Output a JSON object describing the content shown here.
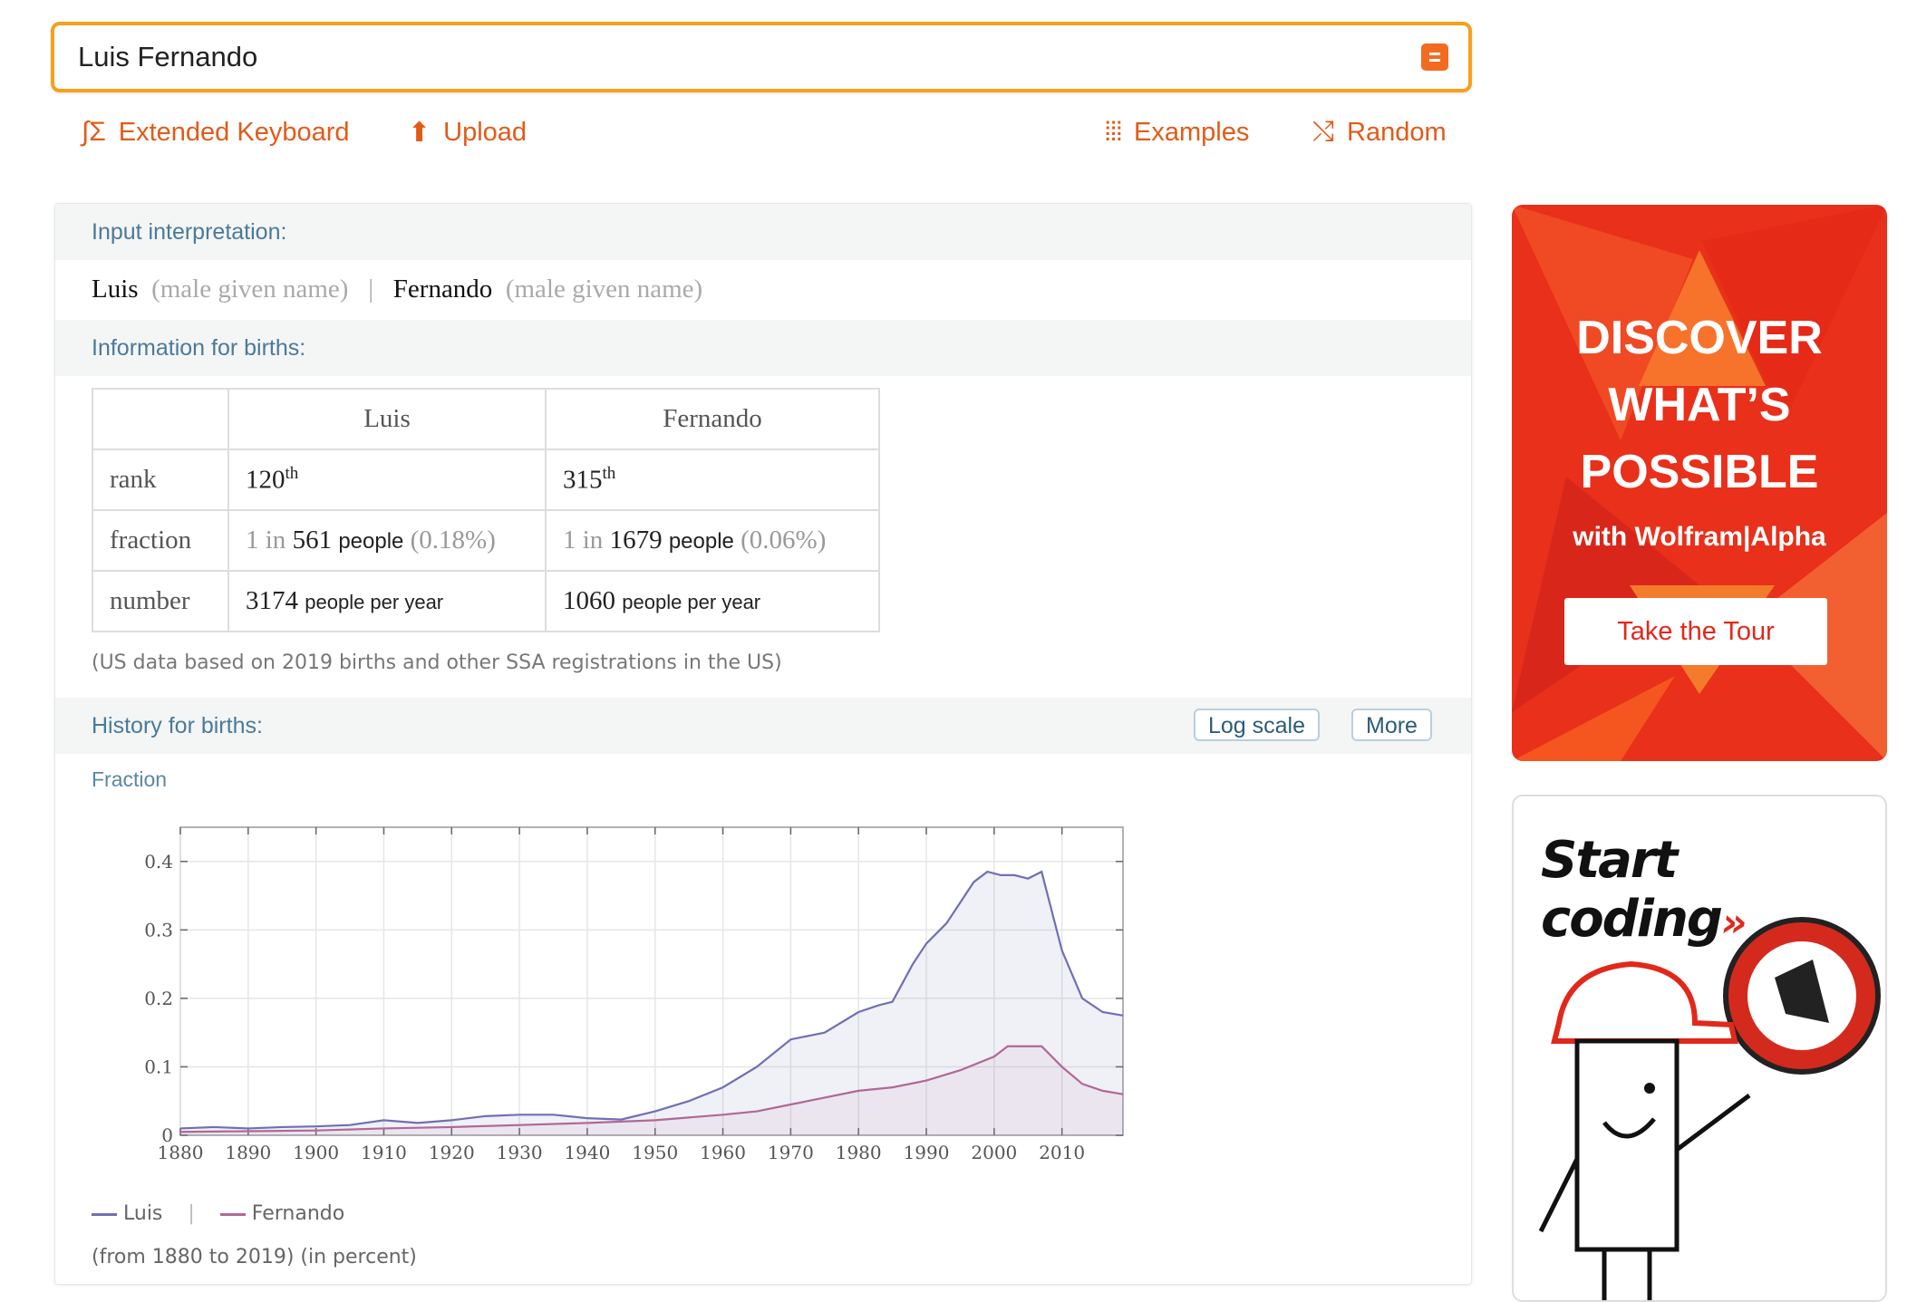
{
  "search": {
    "value": "Luis Fernando"
  },
  "toolbar": {
    "extended_keyboard": "Extended Keyboard",
    "upload": "Upload",
    "examples": "Examples",
    "random": "Random"
  },
  "pods": {
    "input_interpretation": {
      "title": "Input interpretation:",
      "name1": "Luis",
      "type1": "(male given name)",
      "separator": "|",
      "name2": "Fernando",
      "type2": "(male given name)"
    },
    "births_info": {
      "title": "Information for births:",
      "columns": [
        "Luis",
        "Fernando"
      ],
      "rank": {
        "label": "rank",
        "luis": "120",
        "luis_sup": "th",
        "fernando": "315",
        "fernando_sup": "th"
      },
      "fraction": {
        "label": "fraction",
        "luis_prefix": "1 in",
        "luis_value": "561",
        "luis_unit": "people",
        "luis_pct": "(0.18%)",
        "fernando_prefix": "1 in",
        "fernando_value": "1679",
        "fernando_unit": "people",
        "fernando_pct": "(0.06%)"
      },
      "number": {
        "label": "number",
        "luis_value": "3174",
        "luis_unit": "people per year",
        "fernando_value": "1060",
        "fernando_unit": "people per year"
      },
      "note": "(US data based on 2019 births and other SSA registrations in the US)"
    },
    "history": {
      "title": "History for births:",
      "log_scale_button": "Log scale",
      "more_button": "More",
      "subtitle": "Fraction",
      "note": "(from 1880 to 2019)  (in percent)"
    }
  },
  "chart_data": {
    "type": "area",
    "ylabel": "Fraction",
    "xlim": [
      1880,
      2019
    ],
    "ylim": [
      0,
      0.45
    ],
    "x_ticks": [
      "1880",
      "1890",
      "1900",
      "1910",
      "1920",
      "1930",
      "1940",
      "1950",
      "1960",
      "1970",
      "1980",
      "1990",
      "2000",
      "2010"
    ],
    "y_ticks": [
      "0",
      "0.1",
      "0.2",
      "0.3",
      "0.4"
    ],
    "grid": true,
    "legend": "bottom-left",
    "series": [
      {
        "name": "Luis",
        "color": "#6f6fb5",
        "x": [
          1880,
          1885,
          1890,
          1895,
          1900,
          1905,
          1910,
          1915,
          1920,
          1925,
          1930,
          1935,
          1940,
          1945,
          1950,
          1955,
          1960,
          1965,
          1970,
          1975,
          1980,
          1983,
          1985,
          1988,
          1990,
          1993,
          1995,
          1997,
          1999,
          2001,
          2003,
          2005,
          2007,
          2010,
          2013,
          2016,
          2019
        ],
        "values": [
          0.01,
          0.012,
          0.01,
          0.012,
          0.013,
          0.015,
          0.022,
          0.018,
          0.022,
          0.028,
          0.03,
          0.03,
          0.025,
          0.023,
          0.035,
          0.05,
          0.07,
          0.1,
          0.14,
          0.15,
          0.18,
          0.19,
          0.195,
          0.25,
          0.28,
          0.31,
          0.34,
          0.37,
          0.385,
          0.38,
          0.38,
          0.375,
          0.385,
          0.27,
          0.2,
          0.18,
          0.175
        ]
      },
      {
        "name": "Fernando",
        "color": "#b06896",
        "x": [
          1880,
          1890,
          1900,
          1910,
          1920,
          1930,
          1940,
          1950,
          1960,
          1965,
          1970,
          1975,
          1980,
          1985,
          1990,
          1995,
          2000,
          2002,
          2005,
          2007,
          2010,
          2013,
          2016,
          2019
        ],
        "values": [
          0.005,
          0.006,
          0.007,
          0.01,
          0.012,
          0.015,
          0.018,
          0.022,
          0.03,
          0.035,
          0.045,
          0.055,
          0.065,
          0.07,
          0.08,
          0.095,
          0.115,
          0.13,
          0.13,
          0.13,
          0.1,
          0.075,
          0.065,
          0.06
        ]
      }
    ]
  },
  "ads": {
    "ad1": {
      "line1": "DISCOVER",
      "line2": "WHAT’S",
      "line3": "POSSIBLE",
      "line4": "with Wolfram|Alpha",
      "button": "Take the Tour"
    },
    "ad2": {
      "title": "Start coding",
      "arrows": "»"
    }
  }
}
